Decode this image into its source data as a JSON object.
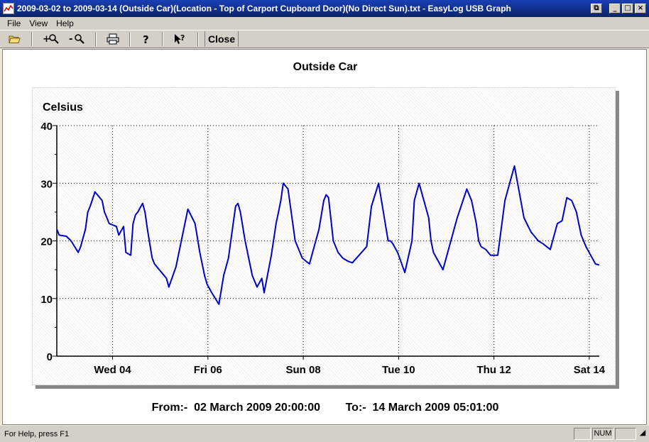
{
  "window": {
    "title": "2009-03-02 to 2009-03-14 (Outside Car)(Location - Top of Carport Cupboard Door)(No Direct Sun).txt - EasyLog USB Graph",
    "buttons": {
      "restore": "⧉",
      "minimize": "_",
      "maximize": "□",
      "close": "×"
    }
  },
  "menu": {
    "items": [
      "File",
      "View",
      "Help"
    ]
  },
  "toolbar": {
    "icons": [
      "open-folder-icon",
      "zoom-in-icon",
      "zoom-out-icon",
      "printer-icon",
      "help-icon",
      "context-help-icon"
    ],
    "close_label": "Close"
  },
  "graph": {
    "title": "Outside Car",
    "from_label": "From:-",
    "from_value": "02 March 2009 20:00:00",
    "to_label": "To:-",
    "to_value": "14 March 2009 05:01:00"
  },
  "chart_data": {
    "type": "line",
    "title": "Outside Car",
    "ylabel": "Celsius",
    "ylim": [
      0,
      40
    ],
    "yticks": [
      0,
      10,
      20,
      30,
      40
    ],
    "xlim": [
      0,
      11.38
    ],
    "xticks": [
      {
        "x": 1.17,
        "label": "Wed 04"
      },
      {
        "x": 3.17,
        "label": "Fri 06"
      },
      {
        "x": 5.17,
        "label": "Sun 08"
      },
      {
        "x": 7.17,
        "label": "Tue 10"
      },
      {
        "x": 9.17,
        "label": "Thu 12"
      },
      {
        "x": 11.17,
        "label": "Sat 14"
      }
    ],
    "grid": true,
    "line_color": "#0000cc",
    "series": [
      {
        "x": [
          0,
          0.05,
          0.2,
          0.3,
          0.45,
          0.5,
          0.6,
          0.65,
          0.7,
          0.8,
          0.95,
          1.0,
          1.05,
          1.1,
          1.25,
          1.3,
          1.4,
          1.45,
          1.55,
          1.6,
          1.65,
          1.7,
          1.8,
          1.85,
          1.9,
          2.0,
          2.05,
          2.1,
          2.15,
          2.2,
          2.3,
          2.35,
          2.5,
          2.75,
          2.9,
          3.0,
          3.1,
          3.15,
          3.25,
          3.4,
          3.5,
          3.6,
          3.7,
          3.75,
          3.8,
          3.85,
          3.95,
          4.1,
          4.2,
          4.3,
          4.35,
          4.5,
          4.6,
          4.65,
          4.7,
          4.75,
          4.85,
          5.0,
          5.1,
          5.15,
          5.3,
          5.5,
          5.6,
          5.65,
          5.7,
          5.8,
          5.9,
          6.0,
          6.1,
          6.2,
          6.5,
          6.6,
          6.75,
          6.95,
          7.0,
          7.05,
          7.15,
          7.3,
          7.45,
          7.5,
          7.6,
          7.8,
          7.85,
          7.9,
          8.0,
          8.1,
          8.2,
          8.4,
          8.6,
          8.7,
          8.8,
          8.85,
          8.9,
          9.0,
          9.1,
          9.25,
          9.4,
          9.6,
          9.8,
          9.95,
          10.0,
          10.1,
          10.2,
          10.35,
          10.5,
          10.6,
          10.7,
          10.8,
          10.9,
          10.95,
          11.0,
          11.1,
          11.2,
          11.3,
          11.38
        ],
        "values": [
          22,
          21,
          20.8,
          20,
          18,
          19,
          22,
          25,
          26,
          28.5,
          27,
          25,
          24,
          23,
          22.5,
          21,
          22.5,
          18,
          17.5,
          23,
          24.5,
          25,
          26.5,
          25,
          22,
          17,
          16,
          15.5,
          15,
          14.5,
          13.5,
          12,
          15.5,
          25.5,
          23,
          18,
          14,
          12.5,
          11,
          9,
          14,
          17,
          23,
          26,
          26.5,
          25,
          20,
          14,
          12,
          13.5,
          11,
          17.5,
          23,
          25,
          27,
          30,
          29,
          20,
          18,
          17,
          16,
          22,
          27,
          28,
          27.5,
          20,
          18,
          17,
          16.5,
          16.2,
          19,
          26,
          30,
          20,
          20,
          19.5,
          18,
          14.5,
          20,
          27,
          30,
          24,
          20,
          18,
          16.5,
          15,
          18,
          24,
          29,
          27,
          23,
          20,
          19,
          18.5,
          17.5,
          17.5,
          27,
          33,
          24,
          21.5,
          21,
          20,
          19.5,
          18.5,
          23,
          23.5,
          27.5,
          27,
          25,
          23,
          21,
          19,
          17.5,
          16,
          15.8
        ]
      }
    ]
  },
  "status": {
    "help_text": "For Help, press F1",
    "num": "NUM"
  }
}
